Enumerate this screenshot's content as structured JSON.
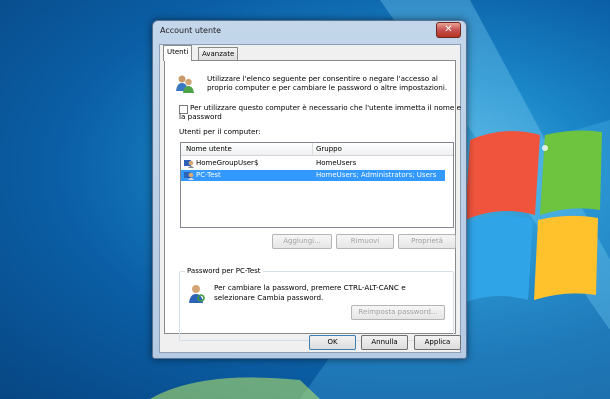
{
  "window": {
    "title": "Account utente",
    "close_glyph": "✕"
  },
  "tabs": [
    {
      "label": "Utenti"
    },
    {
      "label": "Avanzate"
    }
  ],
  "intro": {
    "line1": "Utilizzare l'elenco seguente per consentire o negare l'accesso al",
    "line2": "proprio computer e per cambiare le password o altre impostazioni.",
    "icon": "users-icon"
  },
  "require_password": {
    "line1": "Per utilizzare questo computer è necessario che l'utente immetta il nome e",
    "line2": "la password",
    "checked": false
  },
  "users_label": "Utenti per il computer:",
  "table": {
    "headers": [
      "Nome utente",
      "Gruppo"
    ],
    "rows": [
      {
        "name": "HomeGroupUser$",
        "group": "HomeUsers",
        "selected": false
      },
      {
        "name": "PC-Test",
        "group": "HomeUsers; Administrators; Users",
        "selected": true
      }
    ]
  },
  "list_buttons": {
    "add": "Aggiungi...",
    "remove": "Rimuovi",
    "properties": "Proprietà"
  },
  "password_group": {
    "label": "Password per PC-Test",
    "line1": "Per cambiare la password, premere CTRL-ALT-CANC e",
    "line2": "selezionare Cambia password.",
    "reset_button": "Reimposta password...",
    "icon": "user-key-icon"
  },
  "dialog_buttons": {
    "ok": "OK",
    "cancel": "Annulla",
    "apply": "Applica"
  },
  "colors": {
    "selection": "#3399ff",
    "desktop": "#1a86c8"
  }
}
